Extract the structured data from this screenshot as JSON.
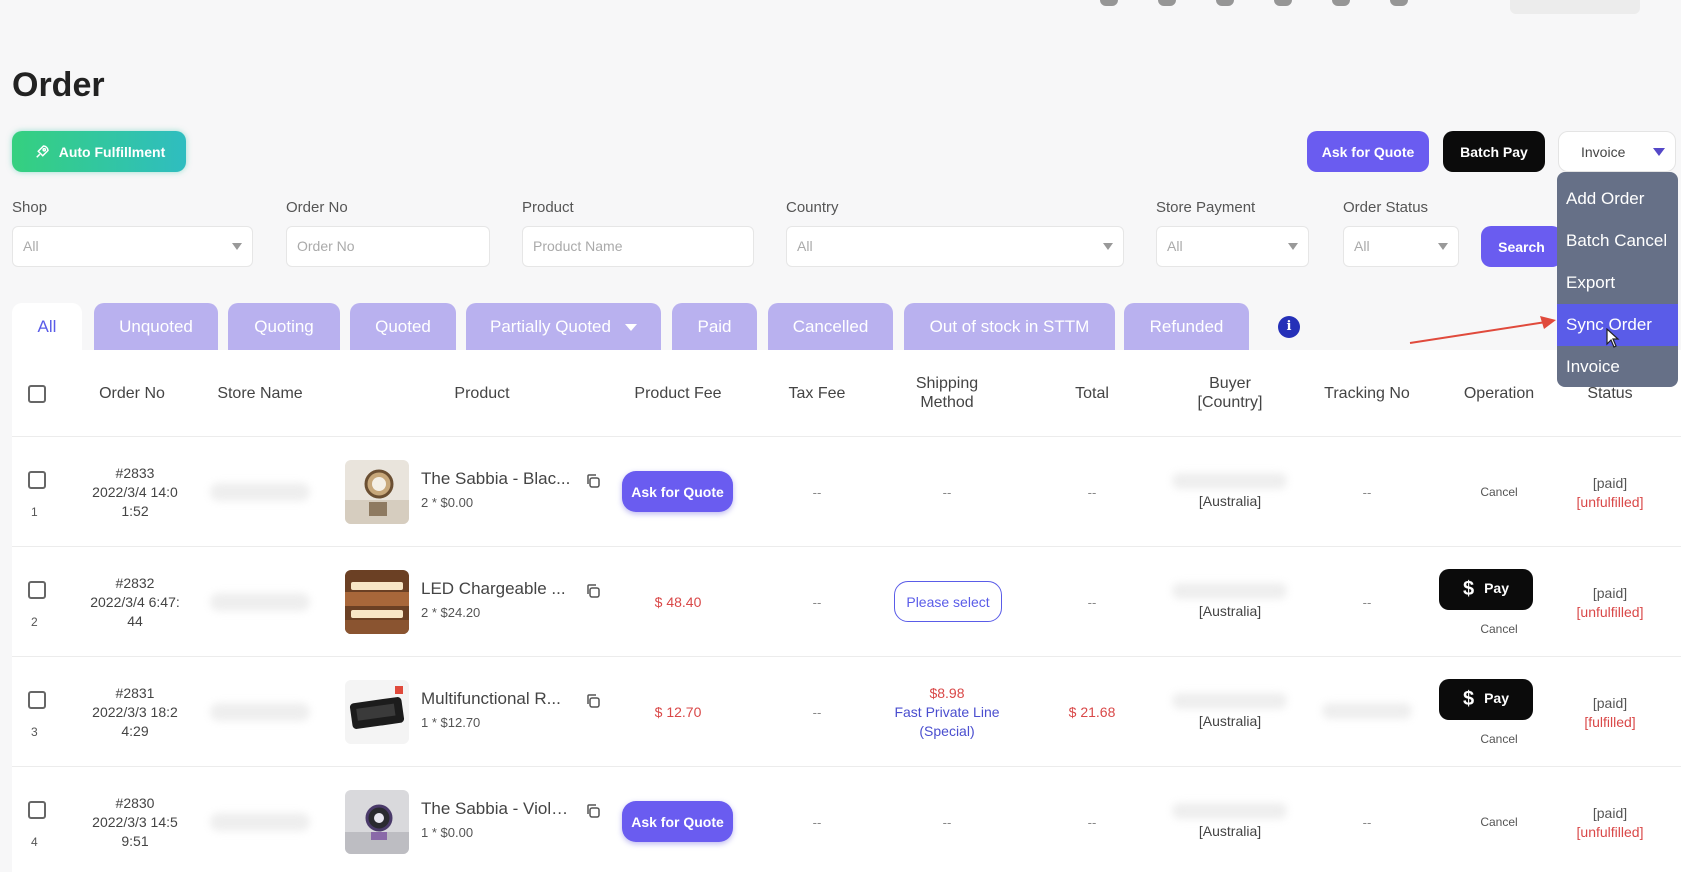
{
  "page": {
    "title": "Order"
  },
  "toolbar": {
    "auto_fulfillment_label": "Auto Fulfillment",
    "ask_for_quote_label": "Ask for Quote",
    "batch_pay_label": "Batch Pay",
    "invoice_select_value": "Invoice"
  },
  "dropdown": {
    "items": [
      "Add Order",
      "Batch Cancel",
      "Export",
      "Sync Order",
      "Invoice"
    ],
    "active_index": 3
  },
  "filters": {
    "shop": {
      "label": "Shop",
      "value": "All"
    },
    "order_no": {
      "label": "Order No",
      "placeholder": "Order No"
    },
    "product": {
      "label": "Product",
      "placeholder": "Product Name"
    },
    "country": {
      "label": "Country",
      "value": "All"
    },
    "store_payment": {
      "label": "Store Payment",
      "value": "All"
    },
    "order_status": {
      "label": "Order Status",
      "value": "All"
    },
    "search_label": "Search"
  },
  "tabs": [
    "All",
    "Unquoted",
    "Quoting",
    "Quoted",
    "Partially Quoted",
    "Paid",
    "Cancelled",
    "Out of stock in STTM",
    "Refunded"
  ],
  "table": {
    "headers": {
      "order_no": "Order No",
      "store_name": "Store Name",
      "product": "Product",
      "product_fee": "Product Fee",
      "tax_fee": "Tax Fee",
      "shipping_method_1": "Shipping",
      "shipping_method_2": "Method",
      "total": "Total",
      "buyer_1": "Buyer",
      "buyer_2": "[Country]",
      "tracking_no": "Tracking No",
      "operation": "Operation",
      "status": "Status"
    },
    "rows": [
      {
        "num": "1",
        "order_no": "#2833",
        "date_1": "2022/3/4 14:0",
        "date_2": "1:52",
        "product_name": "The Sabbia - Blac...",
        "product_qty": "2 * $0.00",
        "ask_label": "Ask for Quote",
        "tax_fee": "--",
        "shipping": "--",
        "total": "--",
        "country": "[Australia]",
        "tracking": "--",
        "cancel": "Cancel",
        "status_1": "[paid]",
        "status_2": "[unfulfilled]"
      },
      {
        "num": "2",
        "order_no": "#2832",
        "date_1": "2022/3/4 6:47:",
        "date_2": "44",
        "product_name": "LED Chargeable ...",
        "product_qty": "2 * $24.20",
        "product_fee": "$ 48.40",
        "tax_fee": "--",
        "shipping_select": "Please select",
        "total": "--",
        "country": "[Australia]",
        "tracking": "--",
        "pay_label": "Pay",
        "cancel": "Cancel",
        "status_1": "[paid]",
        "status_2": "[unfulfilled]"
      },
      {
        "num": "3",
        "order_no": "#2831",
        "date_1": "2022/3/3 18:2",
        "date_2": "4:29",
        "product_name": "Multifunctional R...",
        "product_qty": "1 * $12.70",
        "product_fee": "$ 12.70",
        "tax_fee": "--",
        "shipping_price": "$8.98",
        "shipping_name_1": "Fast Private Line",
        "shipping_name_2": "(Special)",
        "total": "$ 21.68",
        "country": "[Australia]",
        "pay_label": "Pay",
        "cancel": "Cancel",
        "status_1": "[paid]",
        "status_2": "[fulfilled]"
      },
      {
        "num": "4",
        "order_no": "#2830",
        "date_1": "2022/3/3 14:5",
        "date_2": "9:51",
        "product_name": "The Sabbia - Viole...",
        "product_qty": "1 * $0.00",
        "ask_label": "Ask for Quote",
        "tax_fee": "--",
        "shipping": "--",
        "total": "--",
        "country": "[Australia]",
        "tracking": "--",
        "cancel": "Cancel",
        "status_1": "[paid]",
        "status_2": "[unfulfilled]"
      }
    ]
  },
  "colors": {
    "accent": "#6a5cf0",
    "tab_inactive": "#b9b1ef",
    "dropdown_bg": "#667087",
    "dropdown_active": "#5a5ce8",
    "danger": "#d94848",
    "arrow": "#e04a3c"
  }
}
